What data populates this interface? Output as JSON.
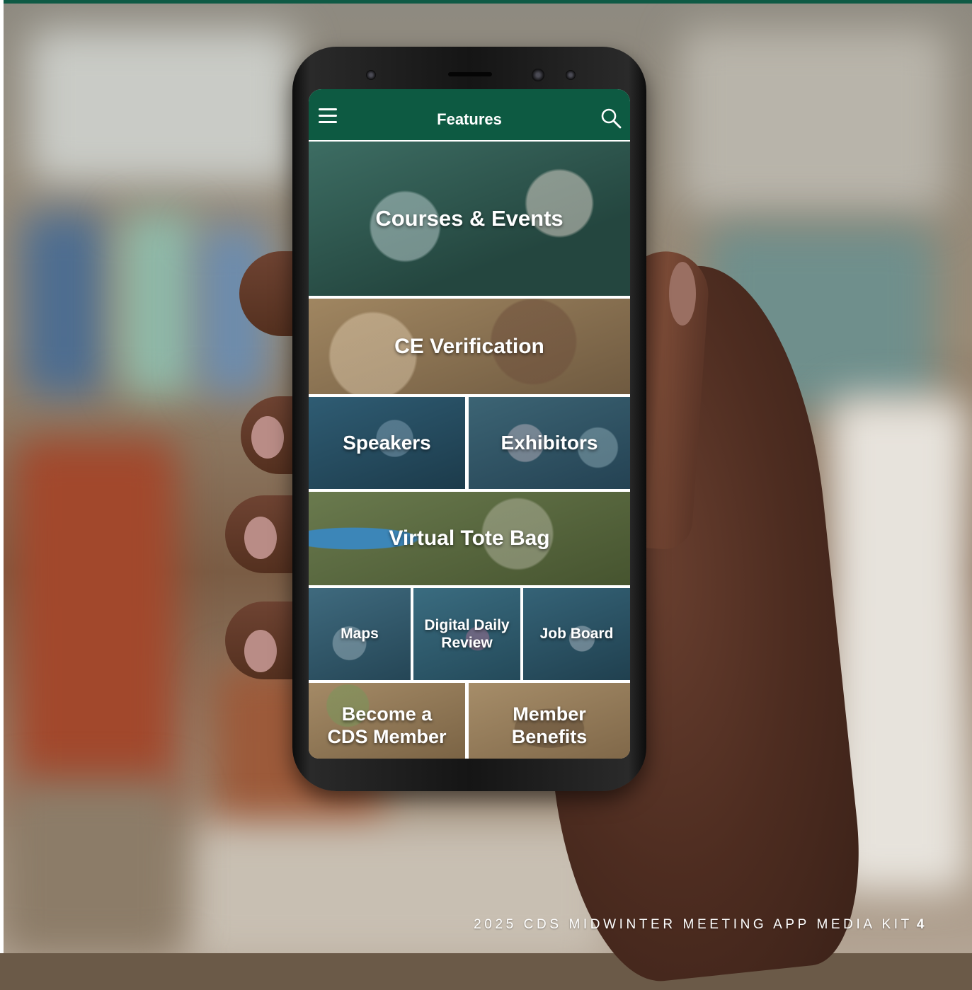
{
  "header": {
    "title": "Features"
  },
  "icons": {
    "menu": "hamburger-menu-icon",
    "search": "search-icon"
  },
  "tiles": {
    "courses": "Courses & Events",
    "ce": "CE Verification",
    "speakers": "Speakers",
    "exhibitors": "Exhibitors",
    "tote": "Virtual Tote Bag",
    "maps": "Maps",
    "digital_line1": "Digital Daily",
    "digital_line2": "Review",
    "job": "Job Board",
    "member_line1": "Become a",
    "member_line2": "CDS Member",
    "benefits_line1": "Member",
    "benefits_line2": "Benefits"
  },
  "footer": {
    "caption": "2025 CDS MIDWINTER MEETING APP MEDIA KIT",
    "page_number": "4"
  },
  "colors": {
    "header_green": "#0d5a42",
    "tile_green": "#2f5d50",
    "tile_tan": "#8a7152",
    "tile_navy": "#284f63",
    "tile_olive": "#55663e"
  }
}
